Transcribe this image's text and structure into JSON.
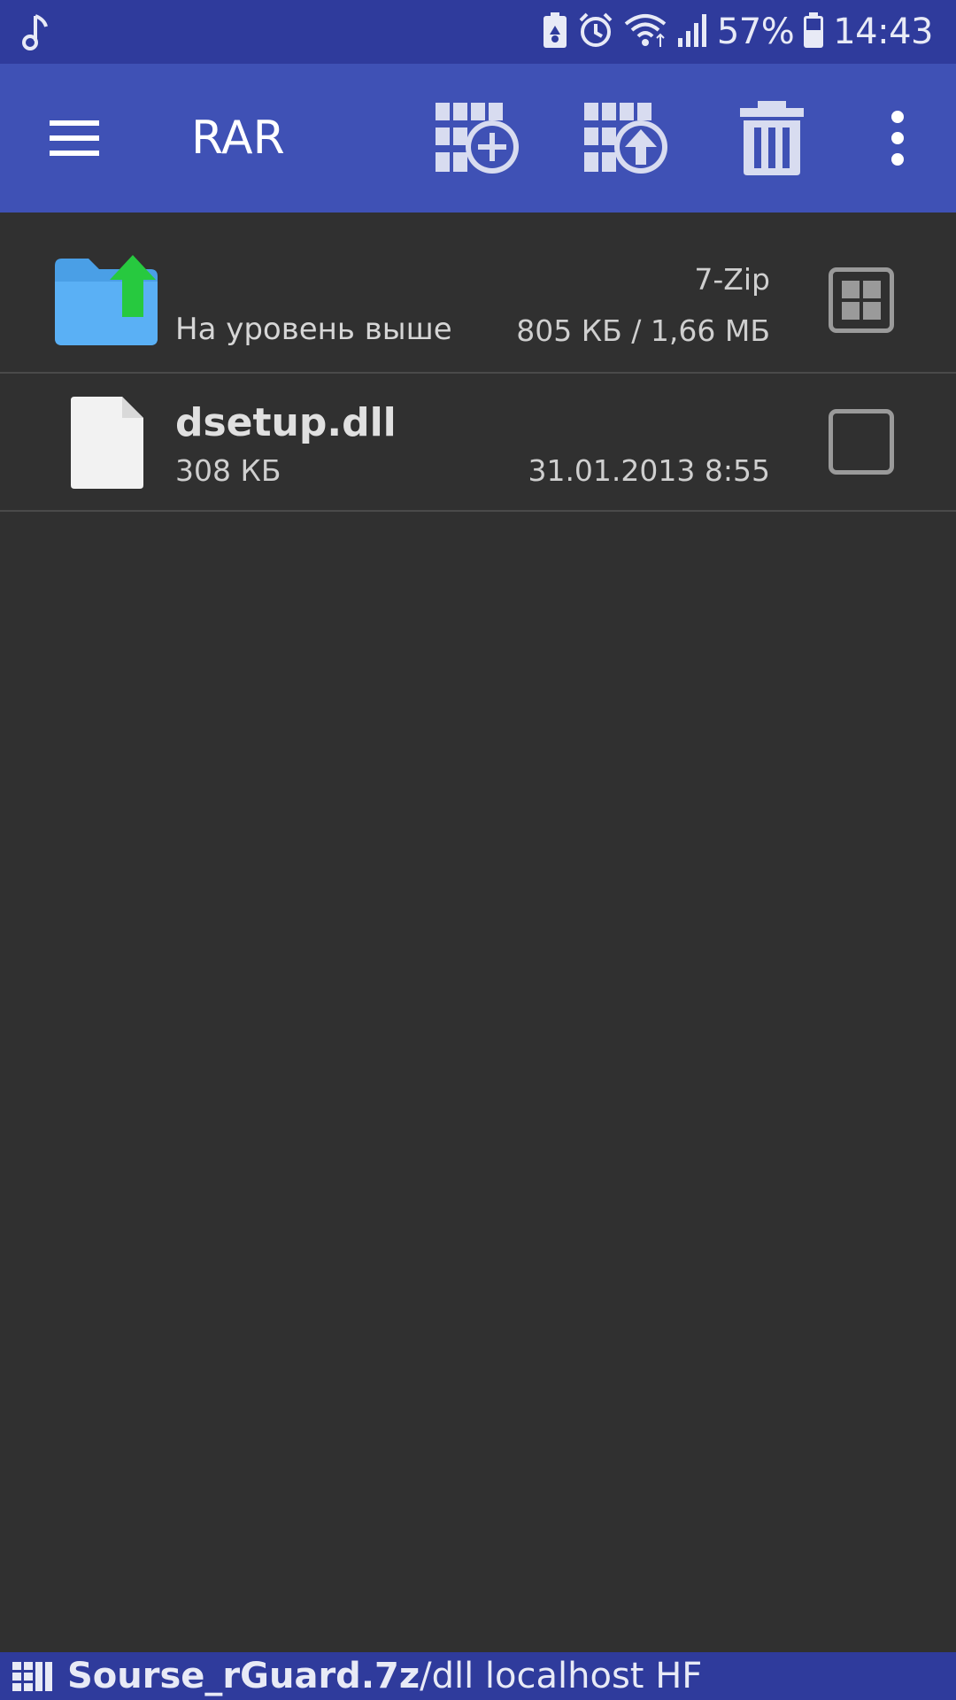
{
  "status_bar": {
    "left_icons": [
      "music-note-icon"
    ],
    "right_icons": [
      "battery-saver-icon",
      "alarm-icon",
      "wifi-icon",
      "signal-icon"
    ],
    "battery_percent": "57%",
    "time": "14:43"
  },
  "toolbar": {
    "title": "RAR",
    "actions": [
      "add-to-archive-icon",
      "extract-icon",
      "delete-icon",
      "more-vert-icon"
    ],
    "accent_color": "#3f51b5"
  },
  "list": {
    "up_row": {
      "label": "На уровень выше",
      "archive_type": "7-Zip",
      "size_info": "805 КБ / 1,66 МБ"
    },
    "items": [
      {
        "name": "dsetup.dll",
        "size": "308 КБ",
        "date": "31.01.2013 8:55",
        "checked": false
      }
    ]
  },
  "path_bar": {
    "archive": "Sourse_rGuard.7z",
    "path": "/dll localhost HF"
  }
}
